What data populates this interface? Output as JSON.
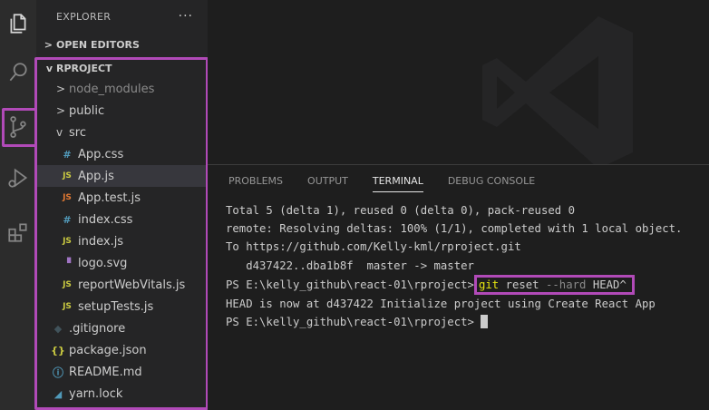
{
  "activity_bar": {
    "items": [
      {
        "name": "explorer",
        "icon": "files-icon"
      },
      {
        "name": "search",
        "icon": "search-icon"
      },
      {
        "name": "source-control",
        "icon": "source-control-icon"
      },
      {
        "name": "run-debug",
        "icon": "run-debug-icon"
      },
      {
        "name": "extensions",
        "icon": "extensions-icon"
      }
    ],
    "highlight_color": "#b14ab8"
  },
  "sidebar": {
    "title": "EXPLORER",
    "more": "···",
    "open_editors": "OPEN EDITORS",
    "project": "RPROJECT",
    "items": [
      {
        "label": "node_modules",
        "type": "folder",
        "expanded": false
      },
      {
        "label": "public",
        "type": "folder",
        "expanded": false
      },
      {
        "label": "src",
        "type": "folder",
        "expanded": true
      },
      {
        "label": "App.css",
        "type": "css-file",
        "icon_glyph": "#",
        "icon_color": "#519aba"
      },
      {
        "label": "App.js",
        "type": "js-file",
        "icon_glyph": "JS",
        "icon_color": "#cbcb41",
        "selected": true
      },
      {
        "label": "App.test.js",
        "type": "test-file",
        "icon_glyph": "JS",
        "icon_color": "#e37933"
      },
      {
        "label": "index.css",
        "type": "css-file",
        "icon_glyph": "#",
        "icon_color": "#519aba"
      },
      {
        "label": "index.js",
        "type": "js-file",
        "icon_glyph": "JS",
        "icon_color": "#cbcb41"
      },
      {
        "label": "logo.svg",
        "type": "svg-file",
        "icon_glyph": "▝",
        "icon_color": "#a074c4"
      },
      {
        "label": "reportWebVitals.js",
        "type": "js-file",
        "icon_glyph": "JS",
        "icon_color": "#cbcb41"
      },
      {
        "label": "setupTests.js",
        "type": "js-file",
        "icon_glyph": "JS",
        "icon_color": "#cbcb41"
      },
      {
        "label": ".gitignore",
        "type": "git-file",
        "icon_glyph": "◆",
        "icon_color": "#41535b"
      },
      {
        "label": "package.json",
        "type": "json-file",
        "icon_glyph": "{}",
        "icon_color": "#cbcb41"
      },
      {
        "label": "README.md",
        "type": "info-file",
        "icon_glyph": "ⓘ",
        "icon_color": "#519aba"
      },
      {
        "label": "yarn.lock",
        "type": "yarn-file",
        "icon_glyph": "◢",
        "icon_color": "#519aba"
      }
    ]
  },
  "panel": {
    "tabs": [
      {
        "label": "PROBLEMS",
        "active": false
      },
      {
        "label": "OUTPUT",
        "active": false
      },
      {
        "label": "TERMINAL",
        "active": true
      },
      {
        "label": "DEBUG CONSOLE",
        "active": false
      }
    ],
    "terminal": {
      "lines": [
        "Total 5 (delta 1), reused 0 (delta 0), pack-reused 0",
        "remote: Resolving deltas: 100% (1/1), completed with 1 local object.",
        "To https://github.com/Kelly-kml/rproject.git",
        "   d437422..dba1b8f  master -> master"
      ],
      "prompt": "PS E:\\kelly_github\\react-01\\rproject>",
      "command_git": "git",
      "command_reset": "reset",
      "command_flag": "--hard",
      "command_target": "HEAD^",
      "result": "HEAD is now at d437422 Initialize project using Create React App",
      "prompt2": "PS E:\\kelly_github\\react-01\\rproject>"
    }
  }
}
